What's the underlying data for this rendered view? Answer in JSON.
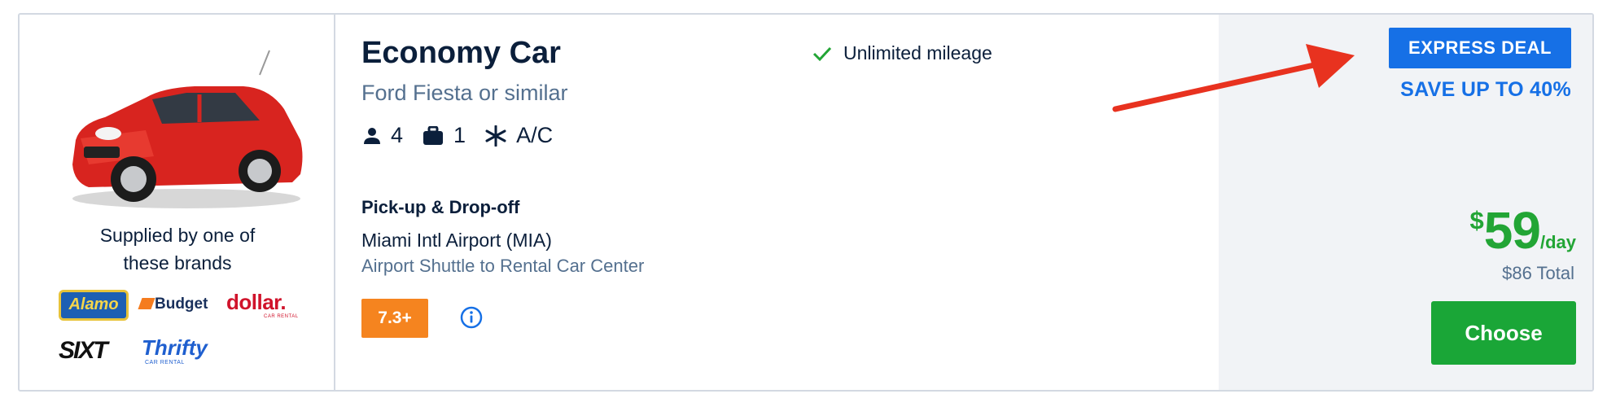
{
  "supplier": {
    "text": "Supplied by one of these brands",
    "brands": [
      "Alamo",
      "Budget",
      "dollar.",
      "SIXT",
      "Thrifty"
    ],
    "dollar_sub": "CAR RENTAL",
    "thrifty_sub": "CAR RENTAL"
  },
  "car": {
    "title": "Economy Car",
    "subtitle": "Ford Fiesta or similar",
    "image_icon": "red-hatchback-car",
    "features": [
      {
        "icon": "person-icon",
        "value": "4"
      },
      {
        "icon": "suitcase-icon",
        "value": "1"
      },
      {
        "icon": "snowflake-icon",
        "value": "A/C"
      }
    ],
    "mileage": "Unlimited mileage"
  },
  "pickup": {
    "heading": "Pick-up & Drop-off",
    "location": "Miami Intl Airport (MIA)",
    "note": "Airport Shuttle to Rental Car Center"
  },
  "rating": {
    "score": "7.3+"
  },
  "deal": {
    "badge": "EXPRESS DEAL",
    "save": "SAVE UP TO 40%"
  },
  "price": {
    "currency": "$",
    "amount": "59",
    "unit": "/day",
    "total": "$86 Total"
  },
  "cta": {
    "label": "Choose"
  },
  "colors": {
    "navy": "#0b1f3b",
    "slate": "#54708f",
    "accent_blue": "#1670e6",
    "green": "#1aa637",
    "price_green": "#22a535",
    "rating_orange": "#f5841f",
    "arrow_red": "#e8321f"
  }
}
